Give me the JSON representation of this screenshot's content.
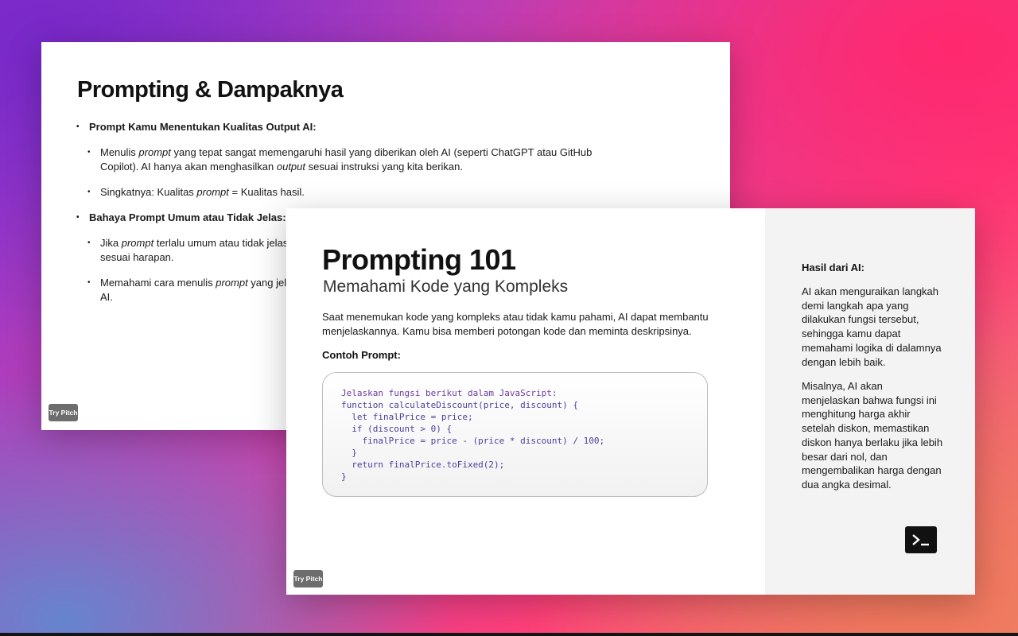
{
  "slide_back": {
    "title": "Prompting & Dampaknya",
    "bullet1": {
      "title": "Prompt Kamu Menentukan Kualitas Output AI:"
    },
    "sub1a": {
      "t1": "Menulis ",
      "t2": "prompt",
      "t3": " yang tepat sangat memengaruhi hasil yang diberikan oleh AI (seperti ChatGPT atau GitHub Copilot). AI hanya akan menghasilkan ",
      "t4": "output",
      "t5": " sesuai instruksi yang kita berikan."
    },
    "sub1b": {
      "t1": "Singkatnya: Kualitas ",
      "t2": "prompt",
      "t3": " = Kualitas hasil."
    },
    "bullet2": {
      "title": "Bahaya Prompt Umum atau Tidak Jelas:"
    },
    "sub2a": {
      "t1": "Jika ",
      "t2": "prompt",
      "t3": " terlalu umum atau tidak jelas,",
      "t4": "sesuai harapan."
    },
    "sub2b": {
      "t1": "Memahami cara menulis ",
      "t2": "prompt",
      "t3": " yang jela",
      "t4": "AI."
    },
    "badge": "Try Pitch"
  },
  "slide_front": {
    "title": "Prompting 101",
    "subtitle": "Memahami Kode yang Kompleks",
    "description": "Saat menemukan kode yang kompleks atau tidak kamu pahami, AI dapat membantu menjelaskannya. Kamu bisa memberi potongan kode dan meminta deskripsinya.",
    "example_label": "Contoh Prompt:",
    "code": {
      "l1": "Jelaskan fungsi berikut dalam JavaScript:",
      "l2": "function calculateDiscount(price, discount) {",
      "l3": "  let finalPrice = price;",
      "l4": "  if (discount > 0) {",
      "l5": "    finalPrice = price - (price * discount) / 100;",
      "l6": "  }",
      "l7": "  return finalPrice.toFixed(2);",
      "l8": "}"
    },
    "side": {
      "heading": "Hasil dari AI:",
      "para1": "AI akan menguraikan langkah demi langkah apa yang dilakukan fungsi tersebut, sehingga kamu dapat memahami logika di dalamnya dengan lebih baik.",
      "para2": "Misalnya, AI akan menjelaskan bahwa fungsi ini menghitung harga akhir setelah diskon, memastikan diskon hanya berlaku jika lebih besar dari nol, dan mengembalikan harga dengan dua angka desimal.",
      "icon": "terminal-icon"
    },
    "badge": "Try Pitch"
  }
}
